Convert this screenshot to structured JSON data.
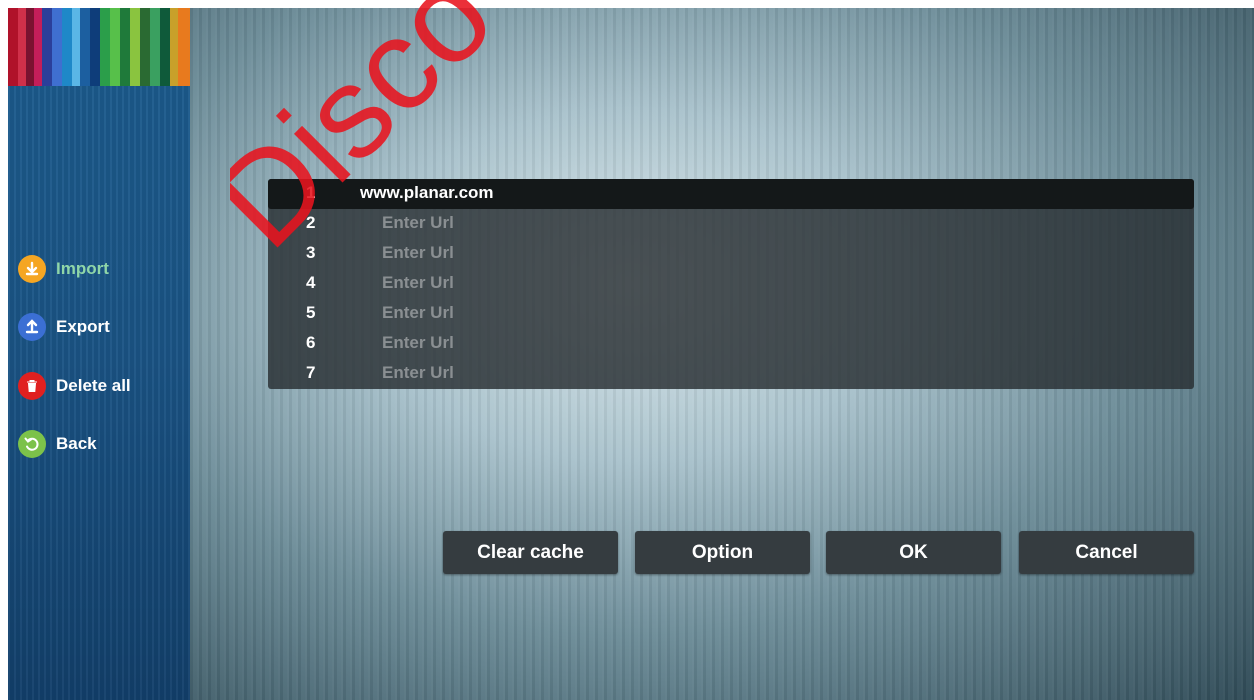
{
  "sidebar": {
    "items": [
      {
        "label": "Import",
        "icon": "download-icon",
        "color": "#f5a623",
        "active": true
      },
      {
        "label": "Export",
        "icon": "upload-icon",
        "color": "#3b6fd4"
      },
      {
        "label": "Delete all",
        "icon": "trash-icon",
        "color": "#e02020"
      },
      {
        "label": "Back",
        "icon": "back-arrow-icon",
        "color": "#7cc24a"
      }
    ]
  },
  "url_list": [
    {
      "num": "1",
      "value": "www.planar.com"
    },
    {
      "num": "2",
      "placeholder": "Enter Url"
    },
    {
      "num": "3",
      "placeholder": "Enter Url"
    },
    {
      "num": "4",
      "placeholder": "Enter Url"
    },
    {
      "num": "5",
      "placeholder": "Enter Url"
    },
    {
      "num": "6",
      "placeholder": "Enter Url"
    },
    {
      "num": "7",
      "placeholder": "Enter Url"
    }
  ],
  "buttons": {
    "clear_cache": "Clear cache",
    "option": "Option",
    "ok": "OK",
    "cancel": "Cancel"
  },
  "watermark": {
    "text": "Disco",
    "color": "#e8131e"
  }
}
